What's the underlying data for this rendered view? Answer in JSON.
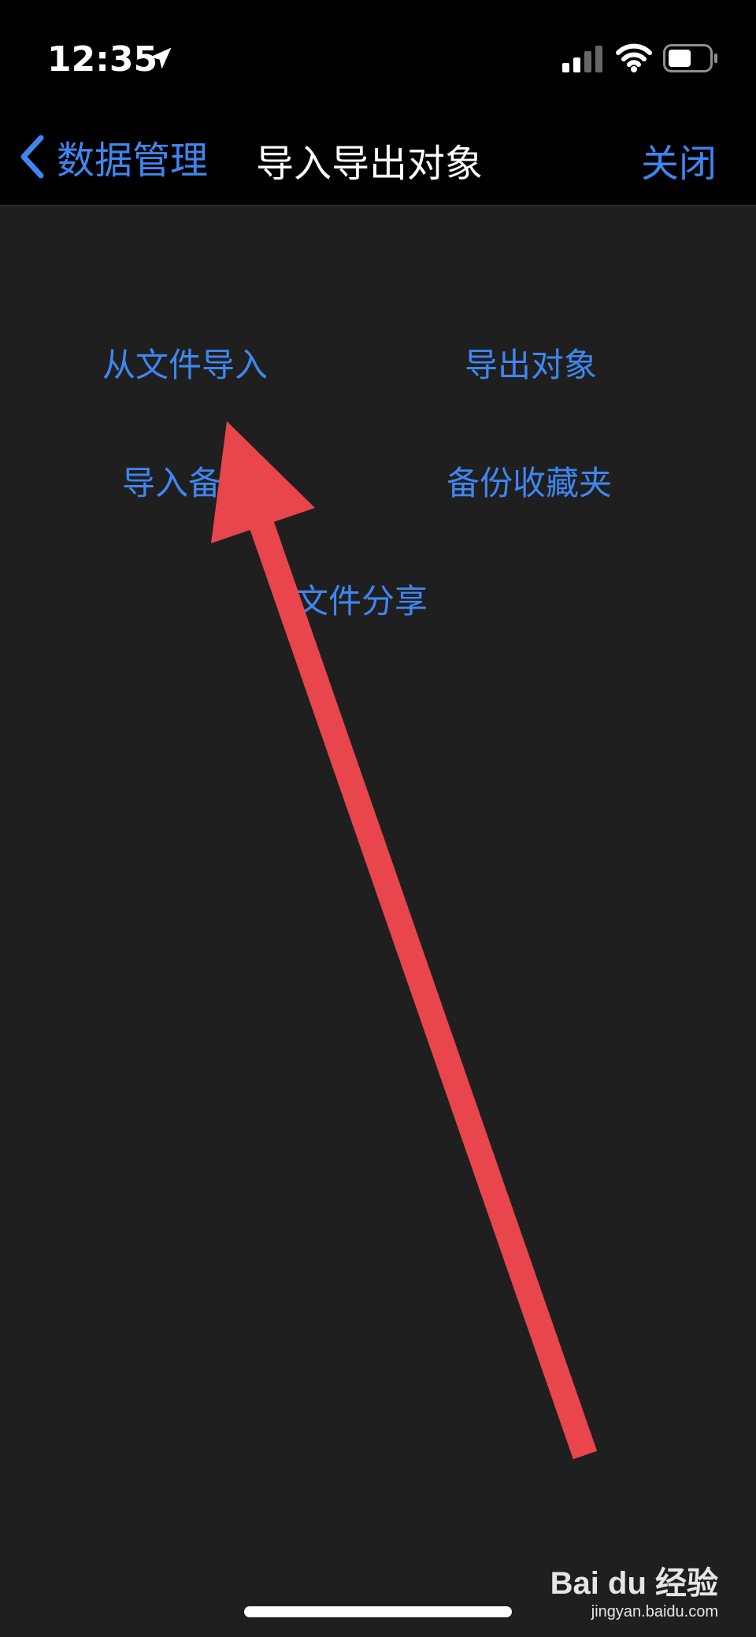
{
  "status_bar": {
    "time": "12:35",
    "icons": [
      "location-icon",
      "cellular-signal-icon",
      "wifi-icon",
      "battery-icon"
    ]
  },
  "nav": {
    "back_label": "数据管理",
    "title": "导入导出对象",
    "close_label": "关闭"
  },
  "actions": {
    "import_from_file": "从文件导入",
    "export_objects": "导出对象",
    "import_backup": "导入备份",
    "backup_favorites": "备份收藏夹",
    "file_sharing": "文件分享"
  },
  "watermark": {
    "brand": "Bai du 经验",
    "url": "jingyan.baidu.com"
  },
  "colors": {
    "background": "#1f1f1f",
    "bar": "#000000",
    "accent": "#3f86f0",
    "annotation_arrow": "#e8454d"
  }
}
